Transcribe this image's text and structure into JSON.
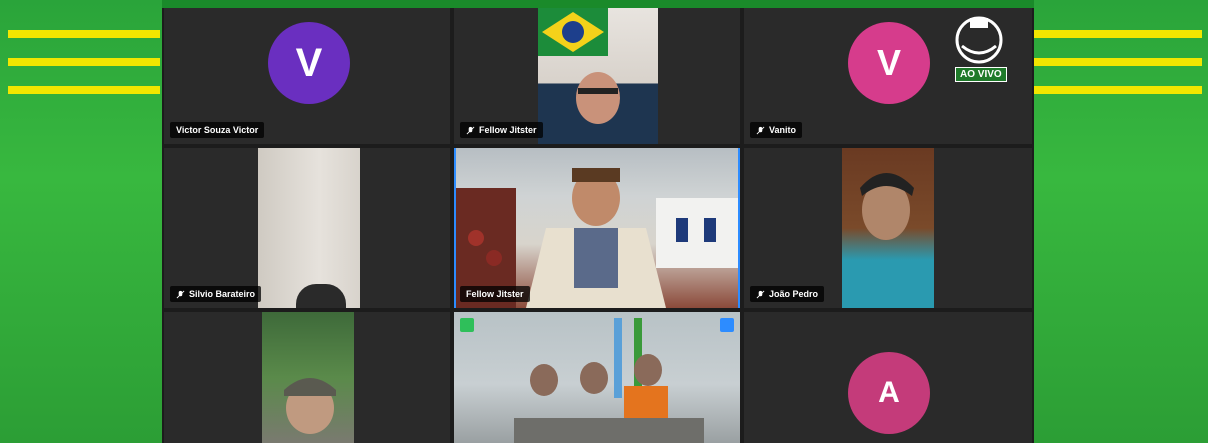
{
  "badge": {
    "live": "AO VIVO"
  },
  "tiles": [
    {
      "name": "Victor Souza Victor",
      "avatar_letter": "V",
      "avatar_color": "#6a2fc0",
      "muted": false
    },
    {
      "name": "Fellow Jitster",
      "muted": true
    },
    {
      "name": "Vanito",
      "avatar_letter": "V",
      "avatar_color": "#d63c8c",
      "muted": true
    },
    {
      "name": "Silvio Barateiro",
      "muted": true
    },
    {
      "name": "Fellow Jitster",
      "muted": false,
      "active": true
    },
    {
      "name": "João Pedro",
      "muted": true
    },
    {
      "name": "",
      "muted": false
    },
    {
      "name": "",
      "muted": false
    },
    {
      "name": "",
      "avatar_letter": "A",
      "avatar_color": "#c43b7a",
      "muted": false
    }
  ],
  "colors": {
    "accent": "#2d8cff",
    "stripe": "#f2e600",
    "background": "#2aa43a"
  }
}
